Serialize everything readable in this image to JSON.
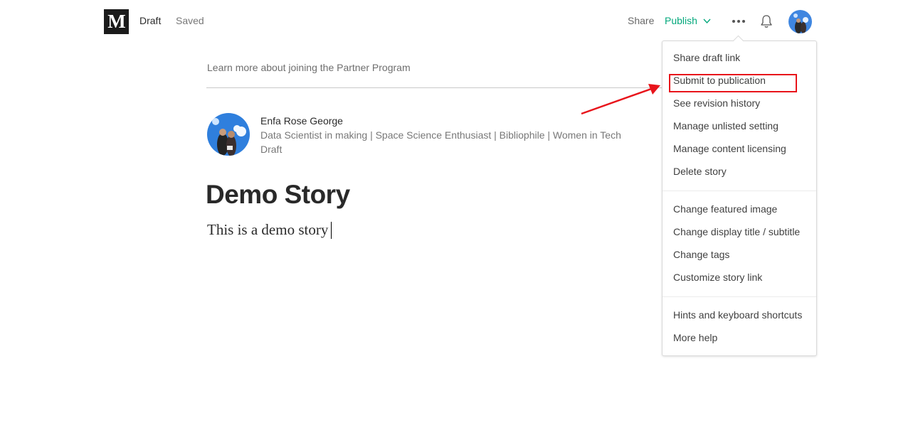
{
  "header": {
    "logo_letter": "M",
    "draft_label": "Draft",
    "saved_label": "Saved",
    "share_label": "Share",
    "publish_label": "Publish"
  },
  "icons": {
    "more": "more-dots-icon",
    "bell": "bell-icon",
    "chevron": "chevron-down-icon"
  },
  "colors": {
    "publish": "#03a87c",
    "annotation": "#e8141b"
  },
  "partner_program_text": "Learn more about joining the Partner Program",
  "author": {
    "name": "Enfa Rose George",
    "bio": "Data Scientist in making | Space Science Enthusiast | Bibliophile | Women in Tech",
    "status": "Draft"
  },
  "story": {
    "title": "Demo Story",
    "body": "This is a demo story"
  },
  "menu": {
    "section1": [
      "Share draft link",
      "Submit to publication",
      "See revision history",
      "Manage unlisted setting",
      "Manage content licensing",
      "Delete story"
    ],
    "section2": [
      "Change featured image",
      "Change display title / subtitle",
      "Change tags",
      "Customize story link"
    ],
    "section3": [
      "Hints and keyboard shortcuts",
      "More help"
    ]
  }
}
